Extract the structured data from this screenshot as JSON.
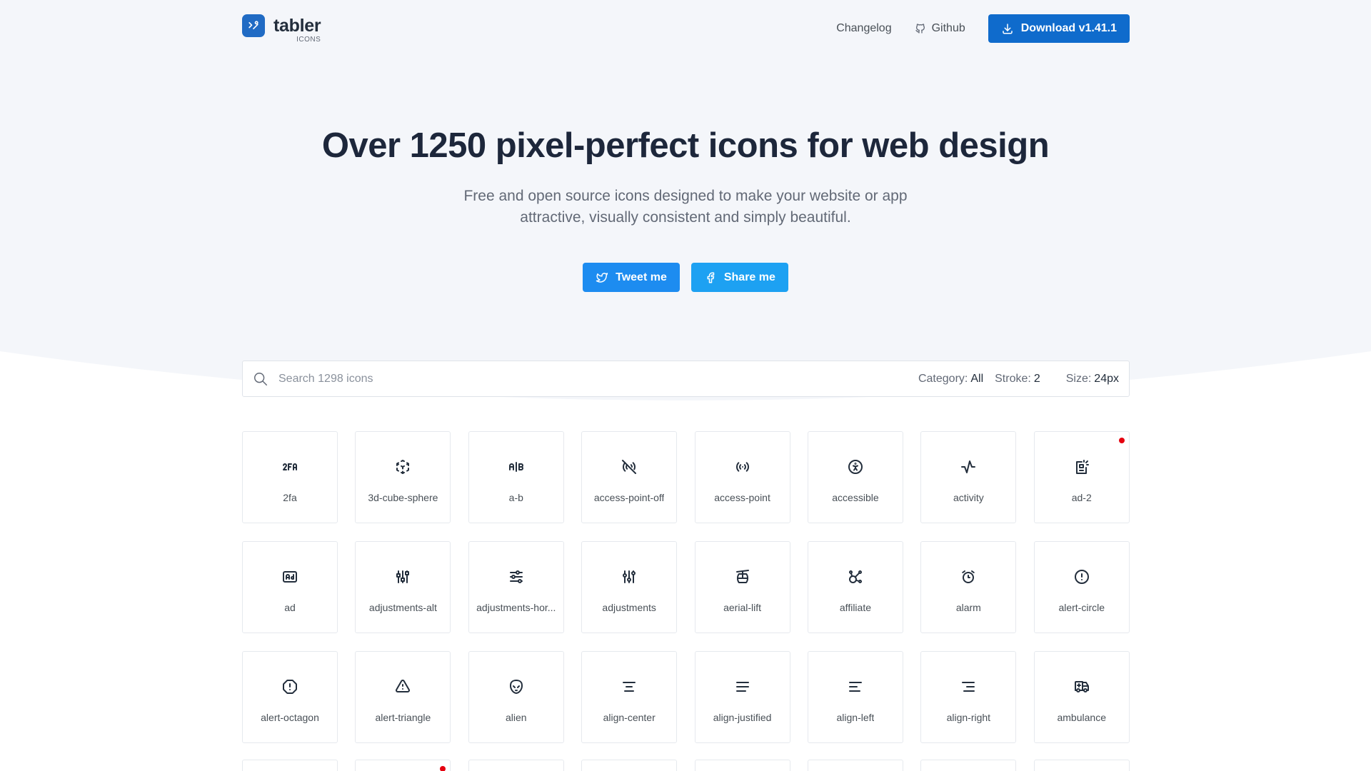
{
  "brand": {
    "name": "tabler",
    "sub": "ICONS"
  },
  "nav": {
    "changelog": "Changelog",
    "github": "Github",
    "download": "Download v1.41.1"
  },
  "hero": {
    "title": "Over 1250 pixel-perfect icons for web design",
    "subtitle": "Free and open source icons designed to make your website or app attractive, visually consistent and simply beautiful.",
    "tweet": "Tweet me",
    "share": "Share me"
  },
  "search": {
    "placeholder": "Search 1298 icons",
    "category_label": "Category:",
    "category_value": "All",
    "stroke_label": "Stroke:",
    "stroke_value": "2",
    "size_label": "Size:",
    "size_value": "24px"
  },
  "icons": [
    {
      "label": "2fa",
      "icon": "2fa-icon"
    },
    {
      "label": "3d-cube-sphere",
      "icon": "3d-cube-sphere-icon"
    },
    {
      "label": "a-b",
      "icon": "a-b-icon"
    },
    {
      "label": "access-point-off",
      "icon": "access-point-off-icon"
    },
    {
      "label": "access-point",
      "icon": "access-point-icon"
    },
    {
      "label": "accessible",
      "icon": "accessible-icon"
    },
    {
      "label": "activity",
      "icon": "activity-icon"
    },
    {
      "label": "ad-2",
      "icon": "ad-2-icon",
      "new": true
    },
    {
      "label": "ad",
      "icon": "ad-icon"
    },
    {
      "label": "adjustments-alt",
      "icon": "adjustments-alt-icon"
    },
    {
      "label": "adjustments-hor...",
      "icon": "adjustments-horizontal-icon"
    },
    {
      "label": "adjustments",
      "icon": "adjustments-icon"
    },
    {
      "label": "aerial-lift",
      "icon": "aerial-lift-icon"
    },
    {
      "label": "affiliate",
      "icon": "affiliate-icon"
    },
    {
      "label": "alarm",
      "icon": "alarm-icon"
    },
    {
      "label": "alert-circle",
      "icon": "alert-circle-icon"
    },
    {
      "label": "alert-octagon",
      "icon": "alert-octagon-icon"
    },
    {
      "label": "alert-triangle",
      "icon": "alert-triangle-icon"
    },
    {
      "label": "alien",
      "icon": "alien-icon"
    },
    {
      "label": "align-center",
      "icon": "align-center-icon"
    },
    {
      "label": "align-justified",
      "icon": "align-justified-icon"
    },
    {
      "label": "align-left",
      "icon": "align-left-icon"
    },
    {
      "label": "align-right",
      "icon": "align-right-icon"
    },
    {
      "label": "ambulance",
      "icon": "ambulance-icon"
    }
  ],
  "colors": {
    "primary": "#206bc4",
    "download": "#0f6bcc",
    "twitter": "#1d8cf0",
    "new_dot": "#e5000f"
  }
}
